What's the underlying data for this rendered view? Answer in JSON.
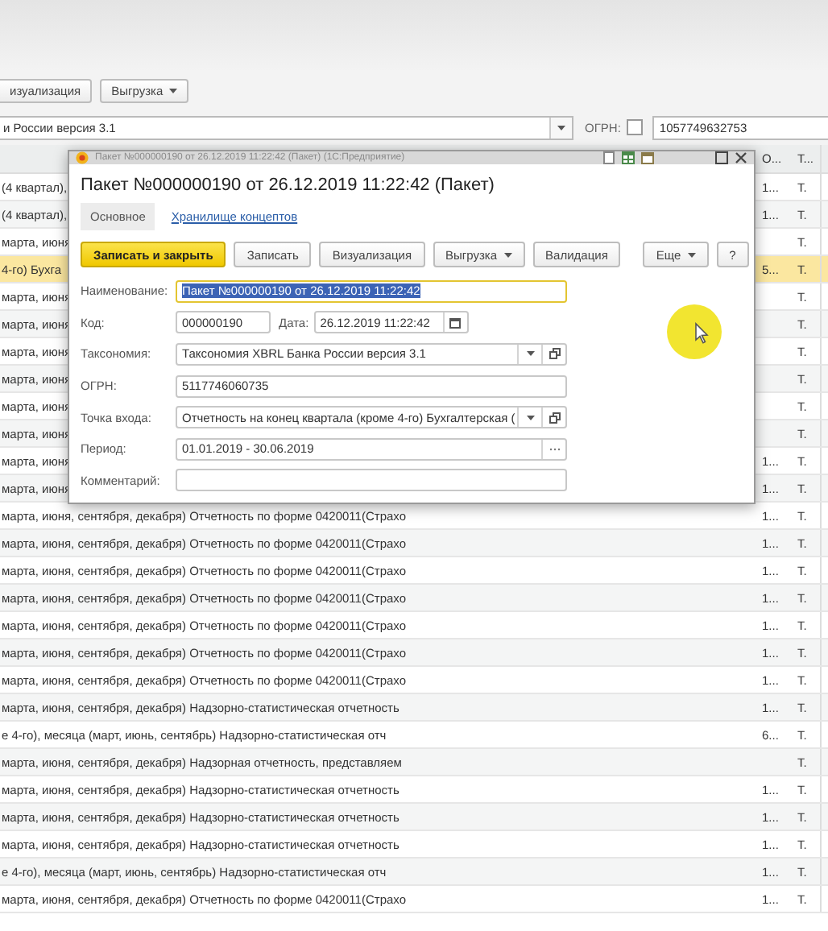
{
  "toolbar": {
    "buttons": [
      {
        "label": "изуализация",
        "kind": "plain"
      },
      {
        "label": "Выгрузка",
        "kind": "menu"
      }
    ]
  },
  "filter": {
    "taxonomy": "и России версия 3.1",
    "ogrn_label": "ОГРН:",
    "ogrn_checked": false,
    "ogrn": "1057749632753"
  },
  "list": {
    "columns": [
      "О...",
      "Т..."
    ],
    "rows": [
      {
        "text": "(4 квартал),",
        "col_2": "1...",
        "col_3": "T.",
        "selected": false
      },
      {
        "text": "(4 квартал),",
        "col_2": "1...",
        "col_3": "T.",
        "selected": false
      },
      {
        "text": "марта, июня",
        "col_3": "T.",
        "selected": false
      },
      {
        "text": "4-го) Бухга",
        "col_2": "5...",
        "col_3": "T.",
        "selected": true
      },
      {
        "text": "марта, июня",
        "col_3": "T.",
        "selected": false
      },
      {
        "text": "марта, июня",
        "col_3": "T.",
        "selected": false
      },
      {
        "text": "марта, июня",
        "col_3": "T.",
        "selected": false
      },
      {
        "text": "марта, июня",
        "col_3": "T.",
        "selected": false
      },
      {
        "text": "марта, июня",
        "col_3": "T.",
        "selected": false
      },
      {
        "text": "марта, июня",
        "col_3": "T.",
        "selected": false
      },
      {
        "text": "марта, июня",
        "col_2": "1...",
        "col_3": "T.",
        "selected": false
      },
      {
        "text": "марта, июня",
        "col_2": "1...",
        "col_3": "T.",
        "selected": false
      },
      {
        "text": "марта, июня, сентября, декабря) Отчетность по форме 0420011(Страхо",
        "col_2": "1...",
        "col_3": "T.",
        "selected": false
      },
      {
        "text": "марта, июня, сентября, декабря) Отчетность по форме 0420011(Страхо",
        "col_2": "1...",
        "col_3": "T.",
        "selected": false
      },
      {
        "text": "марта, июня, сентября, декабря) Отчетность по форме 0420011(Страхо",
        "col_2": "1...",
        "col_3": "T.",
        "selected": false
      },
      {
        "text": "марта, июня, сентября, декабря) Отчетность по форме 0420011(Страхо",
        "col_2": "1...",
        "col_3": "T.",
        "selected": false
      },
      {
        "text": "марта, июня, сентября, декабря) Отчетность по форме 0420011(Страхо",
        "col_2": "1...",
        "col_3": "T.",
        "selected": false
      },
      {
        "text": "марта, июня, сентября, декабря) Отчетность по форме 0420011(Страхо",
        "col_2": "1...",
        "col_3": "T.",
        "selected": false
      },
      {
        "text": "марта, июня, сентября, декабря) Отчетность по форме 0420011(Страхо",
        "col_2": "1...",
        "col_3": "T.",
        "selected": false
      },
      {
        "text": "марта, июня, сентября, декабря) Надзорно-статистическая отчетность",
        "col_2": "1...",
        "col_3": "T.",
        "selected": false
      },
      {
        "text": "е 4-го), месяца (март, июнь, сентябрь) Надзорно-статистическая отч",
        "col_2": "6...",
        "col_3": "T.",
        "selected": false
      },
      {
        "text": "марта, июня, сентября, декабря) Надзорная отчетность, представляем",
        "col_3": "T.",
        "selected": false
      },
      {
        "text": "марта, июня, сентября, декабря) Надзорно-статистическая отчетность",
        "col_2": "1...",
        "col_3": "T.",
        "selected": false
      },
      {
        "text": "марта, июня, сентября, декабря) Надзорно-статистическая отчетность",
        "col_2": "1...",
        "col_3": "T.",
        "selected": false
      },
      {
        "text": "марта, июня, сентября, декабря) Надзорно-статистическая отчетность",
        "col_2": "1...",
        "col_3": "T.",
        "selected": false
      },
      {
        "text": "е 4-го), месяца (март, июнь, сентябрь) Надзорно-статистическая отч",
        "col_2": "1...",
        "col_3": "T.",
        "selected": false
      },
      {
        "text": "марта, июня, сентября, декабря) Отчетность по форме 0420011(Страхо",
        "col_2": "1...",
        "col_3": "T.",
        "selected": false
      }
    ]
  },
  "dialog": {
    "window_title": "Пакет №000000190 от 26.12.2019 11:22:42 (Пакет)  (1С:Предприятие)",
    "heading": "Пакет №000000190 от 26.12.2019 11:22:42 (Пакет)",
    "tabs": [
      {
        "label": "Основное",
        "selected": true
      },
      {
        "label": "Хранилище концептов",
        "selected": false
      }
    ],
    "buttons": [
      {
        "label": "Записать и закрыть",
        "kind": "primary"
      },
      {
        "label": "Записать",
        "kind": "plain"
      },
      {
        "label": "Визуализация",
        "kind": "plain"
      },
      {
        "label": "Выгрузка",
        "kind": "menu"
      },
      {
        "label": "Валидация",
        "kind": "plain"
      }
    ],
    "buttons_right": [
      {
        "label": "Еще",
        "kind": "menu"
      },
      {
        "label": "?",
        "kind": "plain"
      }
    ],
    "fields": [
      {
        "label": "Наименование:",
        "value": "Пакет №000000190 от 26.12.2019 11:22:42",
        "kind": "text",
        "focused": true
      },
      {
        "label": "Код:",
        "value": "000000190",
        "kind": "code",
        "date_label": "Дата:",
        "date": "26.12.2019 11:22:42",
        "focused": false
      },
      {
        "label": "Таксономия:",
        "value": "Таксономия XBRL Банка России версия 3.1",
        "kind": "select",
        "focused": false
      },
      {
        "label": "ОГРН:",
        "value": "5117746060735",
        "kind": "text",
        "focused": false
      },
      {
        "label": "Точка входа:",
        "value": "Отчетность на конец квартала (кроме 4-го) Бухгалтерская (",
        "kind": "select",
        "focused": false
      },
      {
        "label": "Период:",
        "value": "01.01.2019 - 30.06.2019",
        "kind": "picker",
        "focused": false
      },
      {
        "label": "Комментарий:",
        "kind": "text",
        "focused": false
      }
    ]
  }
}
